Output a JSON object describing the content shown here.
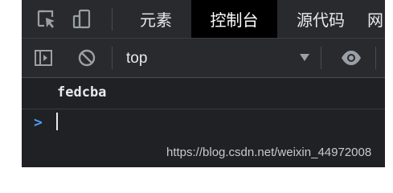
{
  "tabs": [
    {
      "label": "元素",
      "active": false
    },
    {
      "label": "控制台",
      "active": true
    },
    {
      "label": "源代码",
      "active": false
    },
    {
      "label": "网",
      "active": false
    }
  ],
  "toolbar": {
    "context": "top"
  },
  "console": {
    "log_output": "fedcba",
    "prompt_symbol": ">"
  },
  "watermark": "https://blog.csdn.net/weixin_44972008",
  "colors": {
    "background": "#202124",
    "toolbar": "#292a2d",
    "active_tab": "#000000",
    "prompt": "#4d9cf6"
  }
}
